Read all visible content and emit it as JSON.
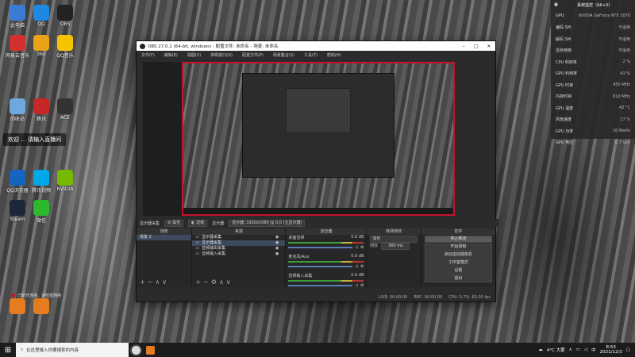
{
  "desktop": {
    "icons": [
      {
        "label": "此电脑",
        "color": "#3a7bd5"
      },
      {
        "label": "QQ",
        "color": "#1e88e5"
      },
      {
        "label": "OBS",
        "color": "#222222"
      },
      {
        "label": "网易云音乐",
        "color": "#d32f2f"
      },
      {
        "label": "360",
        "color": "#e8a317"
      },
      {
        "label": "QQ音乐",
        "color": "#f5c400"
      },
      {
        "label": "回收站",
        "color": "#6fa8dc"
      },
      {
        "label": "腾讯",
        "color": "#c62828"
      },
      {
        "label": "ACE",
        "color": "#333333"
      },
      {
        "label": "Steam",
        "color": "#1b2838"
      },
      {
        "label": "微信",
        "color": "#2eb82e"
      },
      {
        "label": "NVIDIA",
        "color": "#76b900"
      },
      {
        "label": "QQ浏览器",
        "color": "#1565c0"
      },
      {
        "label": "腾讯视频",
        "color": "#00a8e8"
      },
      {
        "label": "",
        "color": "#e57c20"
      },
      {
        "label": "",
        "color": "#e57c20"
      }
    ],
    "tip": "欢迎 ... 请输入直播间"
  },
  "sysmon": {
    "title": "系统监控（Alt+X）",
    "gpu_name": "NVIDIA GeForce RTX 3070",
    "rows": [
      {
        "label": "GPU",
        "value": "NVIDIA GeForce RTX 3070"
      },
      {
        "label": "编码 SM",
        "value": "不适用"
      },
      {
        "label": "解码 SM",
        "value": "不适用"
      },
      {
        "label": "显存使用",
        "value": "不适用"
      },
      {
        "label": "CPU 利用率",
        "value": "2 %"
      },
      {
        "label": "GPU 利用率",
        "value": "43 %"
      },
      {
        "label": "GPU 时钟",
        "value": "450 MHz"
      },
      {
        "label": "内存时钟",
        "value": "810 MHz"
      },
      {
        "label": "GPU 温度",
        "value": "42 °C"
      },
      {
        "label": "风扇速度",
        "value": "17 %"
      },
      {
        "label": "GPU 功率",
        "value": "16 Watts"
      },
      {
        "label": "GPU 电压",
        "value": "0.7 Volt"
      }
    ]
  },
  "obs": {
    "title": "OBS 27.0.1 (64-bit, windows) - 配置文件: 未命名 - 场景: 未命名",
    "menu": [
      "文件(F)",
      "编辑(E)",
      "视图(V)",
      "停靠窗口(D)",
      "配置文件(P)",
      "场景集合(S)",
      "工具(T)",
      "帮助(H)"
    ],
    "preview_bar": {
      "source_label": "显示器采集",
      "properties": "属性",
      "filters": "滤镜",
      "display_label": "显示器",
      "display_value": "显示器: 1920x1080 @ 0,0 (主显示器)"
    },
    "docks": {
      "scenes": {
        "title": "场景",
        "items": [
          "场景 2"
        ]
      },
      "sources": {
        "title": "来源",
        "items": [
          "显示器采集",
          "显示器采集",
          "音频输出采集",
          "音频输入采集"
        ]
      },
      "mixer": {
        "title": "混音器",
        "channels": [
          {
            "name": "桌面音频",
            "db": "0.0 dB"
          },
          {
            "name": "麦克风/Aux",
            "db": "0.0 dB"
          },
          {
            "name": "音频输入采集",
            "db": "0.0 dB"
          }
        ]
      },
      "transitions": {
        "title": "转场特效",
        "type": "淡化",
        "duration_label": "时长",
        "duration": "300 ms"
      },
      "controls": {
        "title": "控件",
        "buttons": [
          "停止推流",
          "开始录制",
          "启动虚拟摄像机",
          "工作室模式",
          "设置",
          "退出"
        ]
      }
    },
    "status": {
      "left": "已断开连接，请检查网络",
      "live": "LIVE: 00:00:00",
      "rec": "REC: 00:00:00",
      "cpu": "CPU: 0.7%, 60.00 fps"
    }
  },
  "taskbar": {
    "search_placeholder": "在这里输入你要搜索的内容",
    "weather": "4°C 大雾",
    "time": "8:53",
    "date": "2021/12/3",
    "lang": "中"
  }
}
